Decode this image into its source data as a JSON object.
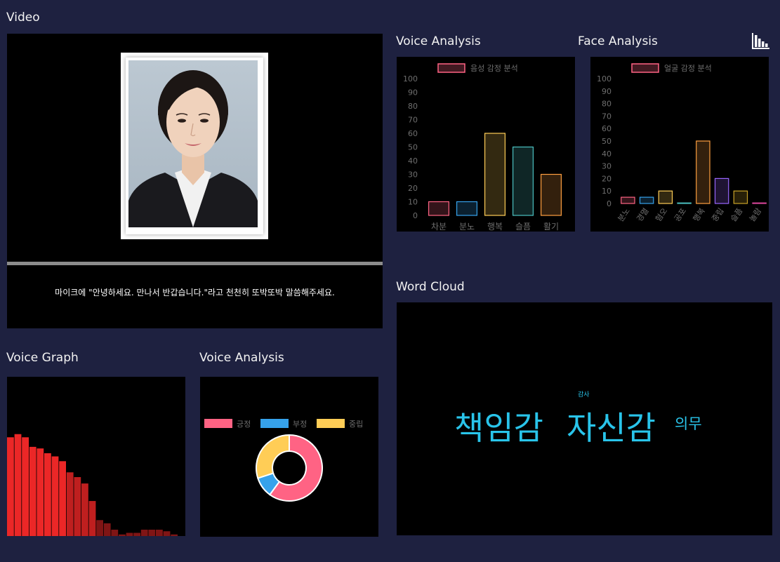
{
  "sections": {
    "video": "Video",
    "voice_analysis_top": "Voice Analysis",
    "face_analysis": "Face Analysis",
    "word_cloud": "Word Cloud",
    "voice_graph": "Voice Graph",
    "voice_analysis_bottom": "Voice Analysis"
  },
  "video": {
    "instruction": "마이크에 \"안녕하세요. 만나서 반갑습니다.\"라고 천천히 또박또박 말씀해주세요."
  },
  "icons": {
    "chart_toggle": "bar-chart-icon"
  },
  "colors": {
    "background": "#1e2140",
    "panel": "#000000",
    "word_cloud": "#29c4ea",
    "voice_graph_bar": "#ff2a2a",
    "positive": "#ff6384",
    "negative": "#36a2eb",
    "neutral": "#ffcd56"
  },
  "chart_data": [
    {
      "id": "voice_emotion",
      "type": "bar",
      "legend": "음성 감정 분석",
      "categories": [
        "차분",
        "분노",
        "행복",
        "슬픔",
        "활기"
      ],
      "values": [
        10,
        10,
        60,
        50,
        30
      ],
      "ylim": [
        0,
        100
      ],
      "yticks": [
        0,
        10,
        20,
        30,
        40,
        50,
        60,
        70,
        80,
        90,
        100
      ],
      "colors": [
        "#ff6384",
        "#36a2eb",
        "#ffcd56",
        "#4bc0c0",
        "#ff9f40"
      ]
    },
    {
      "id": "face_emotion",
      "type": "bar",
      "legend": "얼굴 감정 분석",
      "categories": [
        "분노",
        "경멸",
        "혐오",
        "공포",
        "행복",
        "중립",
        "슬픔",
        "놀람"
      ],
      "values": [
        5,
        5,
        10,
        0,
        50,
        20,
        10,
        0
      ],
      "ylim": [
        0,
        100
      ],
      "yticks": [
        0,
        10,
        20,
        30,
        40,
        50,
        60,
        70,
        80,
        90,
        100
      ],
      "colors": [
        "#ff6384",
        "#36a2eb",
        "#ffcd56",
        "#4bc0c0",
        "#ff9f40",
        "#9966ff",
        "#c9a227",
        "#e0479e"
      ]
    },
    {
      "id": "voice_graph",
      "type": "bar",
      "values": [
        62,
        64,
        62,
        56,
        55,
        52,
        50,
        47,
        40,
        37,
        33,
        22,
        10,
        8,
        4,
        1,
        2,
        2,
        4,
        4,
        4,
        3,
        1
      ],
      "ylim": [
        0,
        100
      ]
    },
    {
      "id": "sentiment",
      "type": "pie",
      "labels": [
        "긍정",
        "부정",
        "중립"
      ],
      "values": [
        60,
        10,
        30
      ],
      "colors": [
        "#ff6384",
        "#36a2eb",
        "#ffcd56"
      ]
    }
  ],
  "word_cloud": {
    "words": [
      {
        "text": "감사",
        "size": 9
      },
      {
        "text": "책임감",
        "size": 46
      },
      {
        "text": "자신감",
        "size": 46
      },
      {
        "text": "의무",
        "size": 21
      }
    ]
  }
}
